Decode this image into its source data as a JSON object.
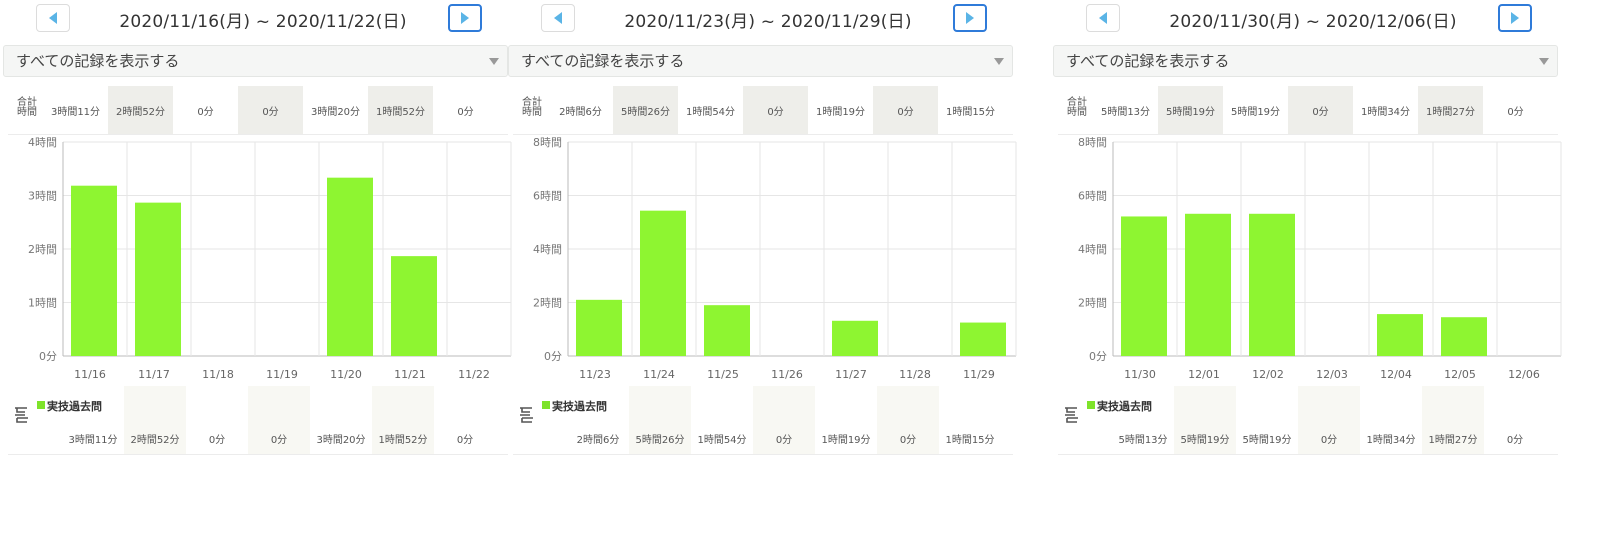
{
  "colors": {
    "bar": "#8ef531",
    "legend": "#7ee32a",
    "grid": "#e6e6e6",
    "nav_next_border": "#2f7bd9",
    "nav_arrow": "#5ab4e6"
  },
  "icons": {
    "prev": "triangle-left-icon",
    "next": "triangle-right-icon",
    "legend": "practice-record-icon",
    "filter": "caret-down-icon"
  },
  "total_label": "合計時間",
  "legend_label": "実技過去問",
  "filter_label": "すべての記録を表示する",
  "panels": [
    {
      "title": "2020/11/16(月) ~ 2020/11/22(日)",
      "totals": [
        "3時間11分",
        "2時間52分",
        "0分",
        "0分",
        "3時間20分",
        "1時間52分",
        "0分"
      ],
      "breakdown": [
        "3時間11分",
        "2時間52分",
        "0分",
        "0分",
        "3時間20分",
        "1時間52分",
        "0分"
      ],
      "chart_data": {
        "type": "bar",
        "categories": [
          "11/16",
          "11/17",
          "11/18",
          "11/19",
          "11/20",
          "11/21",
          "11/22"
        ],
        "series": [
          {
            "name": "実技過去問",
            "values_min": [
              191,
              172,
              0,
              0,
              200,
              112,
              0
            ]
          }
        ],
        "y_ticks": [
          "0分",
          "1時間",
          "2時間",
          "3時間",
          "4時間"
        ],
        "ylim_min": [
          0,
          240
        ]
      }
    },
    {
      "title": "2020/11/23(月) ~ 2020/11/29(日)",
      "totals": [
        "2時間6分",
        "5時間26分",
        "1時間54分",
        "0分",
        "1時間19分",
        "0分",
        "1時間15分"
      ],
      "breakdown": [
        "2時間6分",
        "5時間26分",
        "1時間54分",
        "0分",
        "1時間19分",
        "0分",
        "1時間15分"
      ],
      "chart_data": {
        "type": "bar",
        "categories": [
          "11/23",
          "11/24",
          "11/25",
          "11/26",
          "11/27",
          "11/28",
          "11/29"
        ],
        "series": [
          {
            "name": "実技過去問",
            "values_min": [
              126,
              326,
              114,
              0,
              79,
              0,
              75
            ]
          }
        ],
        "y_ticks": [
          "0分",
          "2時間",
          "4時間",
          "6時間",
          "8時間"
        ],
        "ylim_min": [
          0,
          480
        ]
      }
    },
    {
      "title": "2020/11/30(月) ~ 2020/12/06(日)",
      "totals": [
        "5時間13分",
        "5時間19分",
        "5時間19分",
        "0分",
        "1時間34分",
        "1時間27分",
        "0分"
      ],
      "breakdown": [
        "5時間13分",
        "5時間19分",
        "5時間19分",
        "0分",
        "1時間34分",
        "1時間27分",
        "0分"
      ],
      "chart_data": {
        "type": "bar",
        "categories": [
          "11/30",
          "12/01",
          "12/02",
          "12/03",
          "12/04",
          "12/05",
          "12/06"
        ],
        "series": [
          {
            "name": "実技過去問",
            "values_min": [
              313,
              319,
              319,
              0,
              94,
              87,
              0
            ]
          }
        ],
        "y_ticks": [
          "0分",
          "2時間",
          "4時間",
          "6時間",
          "8時間"
        ],
        "ylim_min": [
          0,
          480
        ]
      }
    }
  ]
}
